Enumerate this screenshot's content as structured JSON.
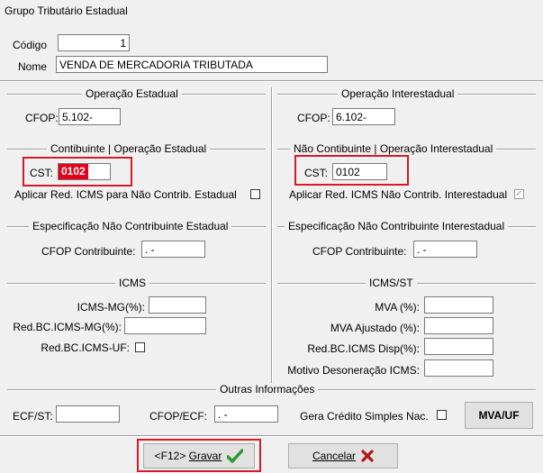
{
  "window": {
    "title": "Grupo Tributário Estadual"
  },
  "header": {
    "codigo_label": "Código",
    "codigo_value": "1",
    "nome_label": "Nome",
    "nome_value": "VENDA DE MERCADORIA TRIBUTADA"
  },
  "op_estadual": {
    "caption": "Operação Estadual",
    "cfop_label": "CFOP:",
    "cfop_value": "5.102-"
  },
  "op_interestadual": {
    "caption": "Operação Interestadual",
    "cfop_label": "CFOP:",
    "cfop_value": "6.102-"
  },
  "contribuinte": {
    "caption": "Contibuinte | Operação Estadual",
    "cst_label": "CST:",
    "cst_value": "0102",
    "aplicar_label": "Aplicar Red. ICMS para Não Contrib. Estadual",
    "aplicar_checked": false
  },
  "nao_contribuinte": {
    "caption": "Não Contibuinte | Operação Interestadual",
    "cst_label": "CST:",
    "cst_value": "0102",
    "aplicar_label": "Aplicar Red. ICMS Não Contrib. Interestadual",
    "aplicar_checked": true
  },
  "espec_estadual": {
    "caption": "Especificação Não Contribuinte Estadual",
    "cfop_label": "CFOP Contribuinte:",
    "cfop_value": ".  -"
  },
  "espec_interestadual": {
    "caption": "Especificação Não Contribuinte Interestadual",
    "cfop_label": "CFOP Contribuinte:",
    "cfop_value": ".  -"
  },
  "icms": {
    "caption": "ICMS",
    "icms_mg_label": "ICMS-MG(%):",
    "icms_mg_value": "",
    "redbc_mg_label": "Red.BC.ICMS-MG(%):",
    "redbc_mg_value": "",
    "redbc_uf_label": "Red.BC.ICMS-UF:",
    "redbc_uf_checked": false
  },
  "icms_st": {
    "caption": "ICMS/ST",
    "mva_label": "MVA (%):",
    "mva_value": "",
    "mva_ajustado_label": "MVA Ajustado (%):",
    "mva_ajustado_value": "",
    "redbc_disp_label": "Red.BC.ICMS Disp(%):",
    "redbc_disp_value": "",
    "motivo_label": "Motivo Desoneração ICMS:",
    "motivo_value": ""
  },
  "outras": {
    "caption": "Outras Informações",
    "ecf_st_label": "ECF/ST:",
    "ecf_st_value": "",
    "cfop_ecf_label": "CFOP/ECF:",
    "cfop_ecf_value": ".  -",
    "gera_credito_label": "Gera Crédito Simples Nac.",
    "gera_credito_checked": false,
    "mva_uf_button": "MVA/UF"
  },
  "footer": {
    "gravar_prefix": "<F12> ",
    "gravar_label": "Gravar",
    "cancelar_label": "Cancelar"
  },
  "colors": {
    "highlight_red": "#d21b2a",
    "check_green": "#2e9a2e",
    "cancel_red": "#b0151b"
  }
}
